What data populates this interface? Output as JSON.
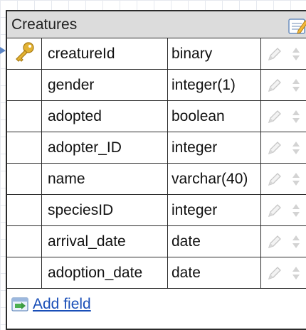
{
  "table": {
    "title": "Creatures",
    "fields": [
      {
        "name": "creatureId",
        "type": "binary",
        "primary_key": true
      },
      {
        "name": "gender",
        "type": "integer(1)",
        "primary_key": false
      },
      {
        "name": "adopted",
        "type": "boolean",
        "primary_key": false
      },
      {
        "name": "adopter_ID",
        "type": "integer",
        "primary_key": false
      },
      {
        "name": "name",
        "type": "varchar(40)",
        "primary_key": false
      },
      {
        "name": "speciesID",
        "type": "integer",
        "primary_key": false
      },
      {
        "name": "arrival_date",
        "type": "date",
        "primary_key": false
      },
      {
        "name": "adoption_date",
        "type": "date",
        "primary_key": false
      }
    ],
    "add_field_label": "Add field"
  },
  "icons": {
    "primary_key": "key-icon",
    "edit_field": "pencil-icon",
    "reorder_field": "up-down-arrows-icon",
    "edit_table": "edit-table-icon",
    "add_field": "add-field-icon"
  },
  "colors": {
    "title_bar": "#dcdcdc",
    "border": "#2b2b2b",
    "link": "#1a4fb8",
    "key": "#e2b233",
    "connector": "#5b84c4"
  }
}
